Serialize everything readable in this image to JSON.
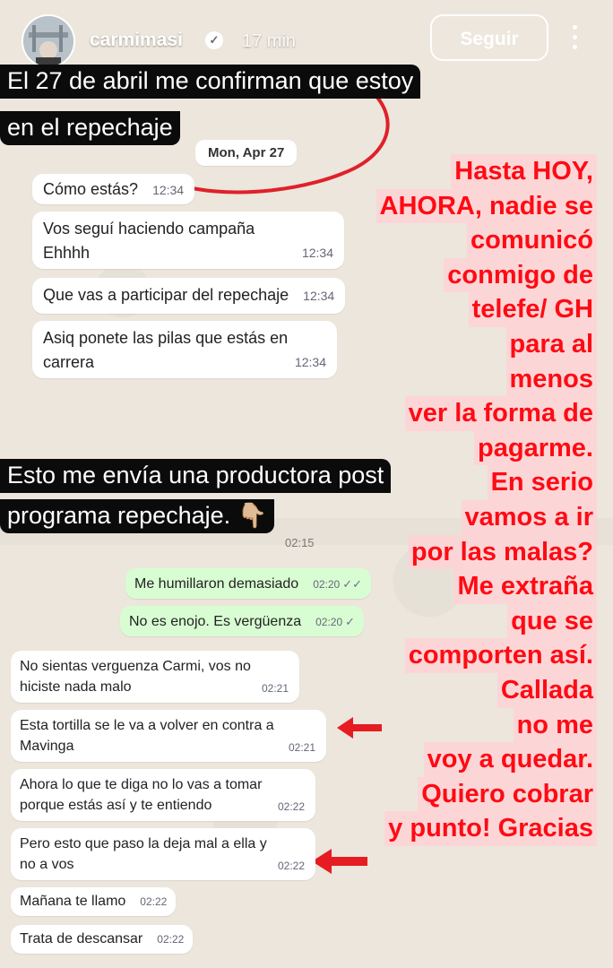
{
  "story": {
    "username": "carmimasi",
    "time_ago": "17 min",
    "follow_label": "Seguir",
    "verified_icon": "verified-badge-icon",
    "more_icon": "more-vertical-icon"
  },
  "captions": {
    "first_line1": "El 27 de abril me confirman que estoy",
    "first_line2": "en el repechaje",
    "second_line1": "Esto me envía una productora post",
    "second_line2": "programa repechaje. 👇🏼"
  },
  "chat1": {
    "date_label": "Mon, Apr 27",
    "messages": [
      {
        "text": "Cómo estás?",
        "time": "12:34"
      },
      {
        "text_line1": "Vos seguí haciendo campaña",
        "text_line2": "Ehhhh",
        "time": "12:34"
      },
      {
        "text": "Que vas a participar del repechaje",
        "time": "12:34"
      },
      {
        "text_line1": "Asiq ponete las pilas que estás en",
        "text_line2": "carrera",
        "time": "12:34"
      }
    ]
  },
  "chat2": {
    "cut_time": "02:15",
    "messages": [
      {
        "text": "Me humillaron demasiado",
        "time": "02:20",
        "direction": "out"
      },
      {
        "text": "No es enojo. Es vergüenza",
        "time": "02:20",
        "direction": "out"
      },
      {
        "text_line1": "No sientas verguenza Carmi, vos no",
        "text_line2": "hiciste nada malo",
        "time": "02:21"
      },
      {
        "text_line1": "Esta tortilla se le va a volver en contra a",
        "text_line2": "Mavinga",
        "time": "02:21"
      },
      {
        "text_line1": "Ahora lo que te diga no lo vas a tomar",
        "text_line2": "porque estás así y te entiendo",
        "time": "02:22"
      },
      {
        "text_line1": "Pero esto que paso la deja mal a ella y",
        "text_line2": "no a vos",
        "time": "02:22"
      },
      {
        "text": "Mañana te llamo",
        "time": "02:22"
      },
      {
        "text": "Trata de descansar",
        "time": "02:22"
      }
    ]
  },
  "overlay_lines": [
    "Hasta HOY,",
    "AHORA, nadie se",
    "comunicó",
    "conmigo de",
    "telefe/ GH",
    "para al",
    "menos",
    "ver la forma de",
    "pagarme.",
    "En serio",
    "vamos a ir",
    "por las malas?",
    "Me extraña",
    "que se",
    "comporten así.",
    "Callada",
    "no me",
    "voy a quedar.",
    "Quiero cobrar",
    "y punto! Gracias"
  ],
  "colors": {
    "overlay_text": "#ff0a14",
    "overlay_bg": "#ffd2d6",
    "outgoing_bubble": "#d9fdd3",
    "incoming_bubble": "#ffffff",
    "caption_bg": "#0b0b0b"
  }
}
